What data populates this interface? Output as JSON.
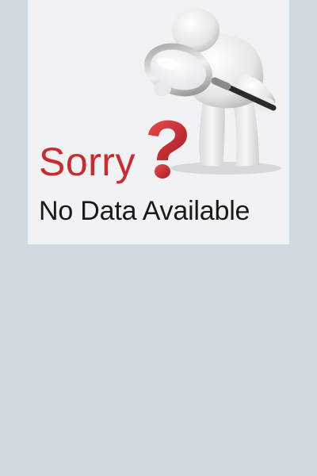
{
  "empty_state": {
    "title": "Sorry",
    "message": "No Data Available",
    "illustration_icon": "magnifier-person-icon",
    "question_icon": "question-mark-icon",
    "colors": {
      "background": "#d1dae0",
      "card": "#f0f2f4",
      "accent": "#cc2a2e",
      "text": "#1a1a1a"
    }
  }
}
